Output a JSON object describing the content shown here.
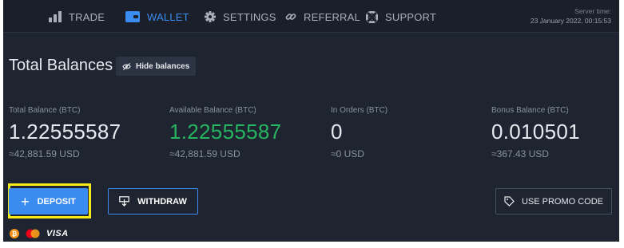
{
  "nav": {
    "items": [
      {
        "label": "TRADE",
        "icon": "bar-chart-icon"
      },
      {
        "label": "WALLET",
        "icon": "wallet-icon",
        "active": true
      },
      {
        "label": "SETTINGS",
        "icon": "gear-icon"
      },
      {
        "label": "REFERRAL",
        "icon": "link-icon"
      },
      {
        "label": "SUPPORT",
        "icon": "lifebuoy-icon"
      }
    ],
    "server_time_label": "Server time:",
    "server_time_value": "23 January 2022, 00:15:53"
  },
  "page": {
    "title": "Total Balances",
    "hide_balances_label": "Hide balances"
  },
  "balances": [
    {
      "label": "Total Balance (BTC)",
      "value": "1.22555587",
      "usd": "≈42,881.59 USD"
    },
    {
      "label": "Available Balance (BTC)",
      "value": "1.22555587",
      "usd": "≈42,881.59 USD"
    },
    {
      "label": "In Orders (BTC)",
      "value": "0",
      "usd": "≈0 USD"
    },
    {
      "label": "Bonus Balance (BTC)",
      "value": "0.010501",
      "usd": "≈367.43 USD"
    }
  ],
  "actions": {
    "deposit_label": "DEPOSIT",
    "withdraw_label": "WITHDRAW",
    "promo_label": "USE PROMO CODE"
  },
  "payment_methods": {
    "icons": [
      "bitcoin-icon",
      "mastercard-icon"
    ],
    "visa_label": "VISA"
  },
  "colors": {
    "accent": "#3b8cf0",
    "positive": "#27b561",
    "highlight": "#f5ea1b",
    "background": "#1e2430"
  }
}
